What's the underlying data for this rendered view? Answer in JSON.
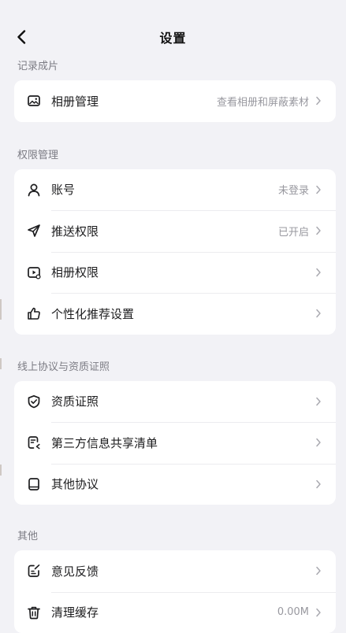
{
  "nav": {
    "title": "设置"
  },
  "sections": [
    {
      "label": "记录成片",
      "items": [
        {
          "label": "相册管理",
          "value": "查看相册和屏蔽素材",
          "icon": "image-icon"
        }
      ]
    },
    {
      "label": "权限管理",
      "items": [
        {
          "label": "账号",
          "value": "未登录",
          "icon": "user-icon"
        },
        {
          "label": "推送权限",
          "value": "已开启",
          "icon": "send-icon"
        },
        {
          "label": "相册权限",
          "value": "",
          "icon": "video-album-icon"
        },
        {
          "label": "个性化推荐设置",
          "value": "",
          "icon": "thumbs-up-icon"
        }
      ]
    },
    {
      "label": "线上协议与资质证照",
      "items": [
        {
          "label": "资质证照",
          "value": "",
          "icon": "shield-check-icon"
        },
        {
          "label": "第三方信息共享清单",
          "value": "",
          "icon": "document-share-icon"
        },
        {
          "label": "其他协议",
          "value": "",
          "icon": "book-icon"
        }
      ]
    },
    {
      "label": "其他",
      "items": [
        {
          "label": "意见反馈",
          "value": "",
          "icon": "feedback-icon"
        },
        {
          "label": "清理缓存",
          "value": "0.00M",
          "icon": "trash-icon"
        }
      ]
    }
  ]
}
